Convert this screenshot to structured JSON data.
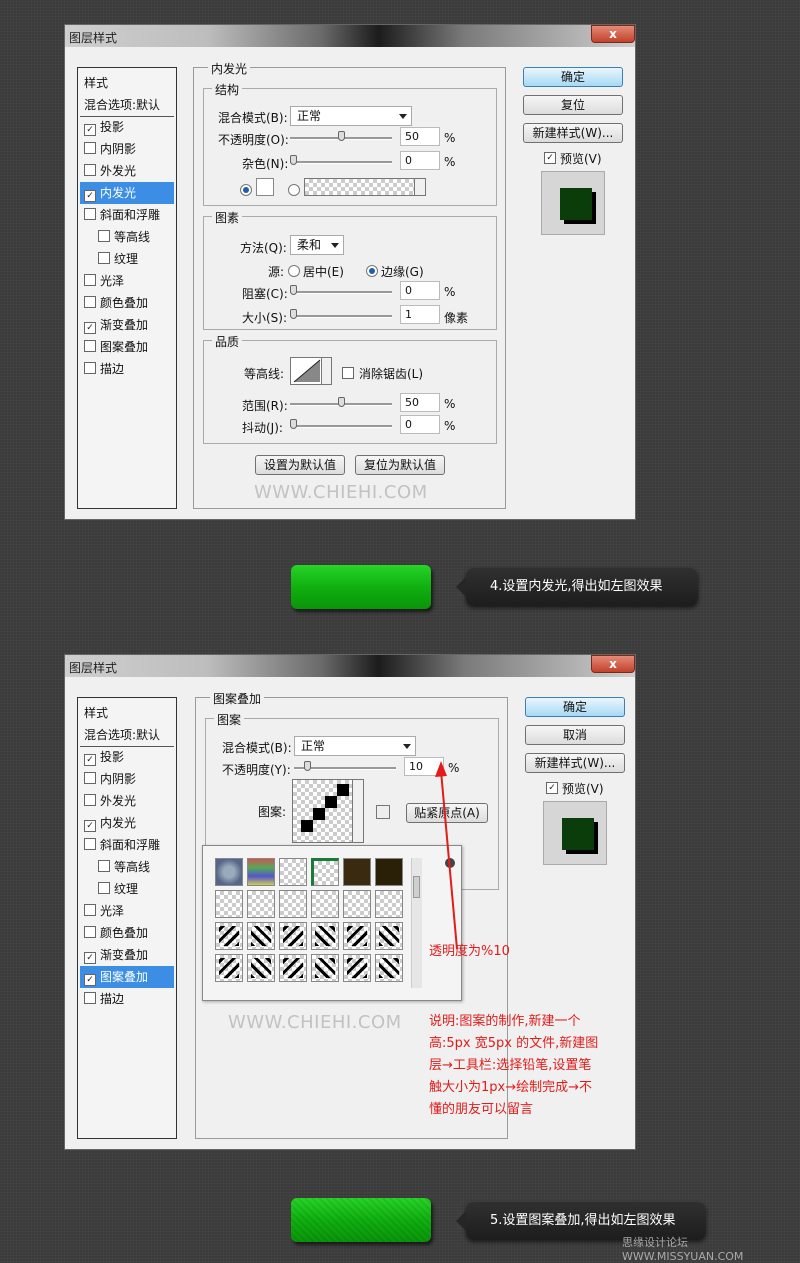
{
  "dialog1": {
    "title": "图层样式",
    "close": "x",
    "list_items": [
      {
        "label": "样式",
        "check": false,
        "checked": false,
        "selected": false,
        "indent": false
      },
      {
        "label": "混合选项:默认",
        "check": false,
        "checked": false,
        "selected": false,
        "indent": false
      },
      {
        "label": "投影",
        "check": true,
        "checked": true,
        "selected": false,
        "indent": false
      },
      {
        "label": "内阴影",
        "check": true,
        "checked": false,
        "selected": false,
        "indent": false
      },
      {
        "label": "外发光",
        "check": true,
        "checked": false,
        "selected": false,
        "indent": false
      },
      {
        "label": "内发光",
        "check": true,
        "checked": true,
        "selected": true,
        "indent": false
      },
      {
        "label": "斜面和浮雕",
        "check": true,
        "checked": false,
        "selected": false,
        "indent": false
      },
      {
        "label": "等高线",
        "check": true,
        "checked": false,
        "selected": false,
        "indent": true
      },
      {
        "label": "纹理",
        "check": true,
        "checked": false,
        "selected": false,
        "indent": true
      },
      {
        "label": "光泽",
        "check": true,
        "checked": false,
        "selected": false,
        "indent": false
      },
      {
        "label": "颜色叠加",
        "check": true,
        "checked": false,
        "selected": false,
        "indent": false
      },
      {
        "label": "渐变叠加",
        "check": true,
        "checked": true,
        "selected": false,
        "indent": false
      },
      {
        "label": "图案叠加",
        "check": true,
        "checked": false,
        "selected": false,
        "indent": false
      },
      {
        "label": "描边",
        "check": true,
        "checked": false,
        "selected": false,
        "indent": false
      }
    ],
    "section_title": "内发光",
    "structure": {
      "title": "结构",
      "blend_label": "混合模式(B):",
      "blend_value": "正常",
      "opacity_label": "不透明度(O):",
      "opacity_value": "50",
      "noise_label": "杂色(N):",
      "noise_value": "0",
      "percent": "%"
    },
    "elements": {
      "title": "图素",
      "method_label": "方法(Q):",
      "method_value": "柔和",
      "source_label": "源:",
      "center_label": "居中(E)",
      "edge_label": "边缘(G)",
      "choke_label": "阻塞(C):",
      "choke_value": "0",
      "size_label": "大小(S):",
      "size_value": "1",
      "px": "像素",
      "percent": "%"
    },
    "quality": {
      "title": "品质",
      "contour_label": "等高线:",
      "antialias_label": "消除锯齿(L)",
      "range_label": "范围(R):",
      "range_value": "50",
      "jitter_label": "抖动(J):",
      "jitter_value": "0",
      "percent": "%"
    },
    "set_default": "设置为默认值",
    "reset_default": "复位为默认值",
    "watermark": "WWW.CHIEHI.COM",
    "ok": "确定",
    "reset": "复位",
    "new_style": "新建样式(W)...",
    "preview_label": "预览(V)"
  },
  "step4": {
    "caption": "4.设置内发光,得出如左图效果"
  },
  "dialog2": {
    "title": "图层样式",
    "close": "x",
    "list_items": [
      {
        "label": "样式",
        "check": false,
        "checked": false,
        "selected": false,
        "indent": false
      },
      {
        "label": "混合选项:默认",
        "check": false,
        "checked": false,
        "selected": false,
        "indent": false
      },
      {
        "label": "投影",
        "check": true,
        "checked": true,
        "selected": false,
        "indent": false
      },
      {
        "label": "内阴影",
        "check": true,
        "checked": false,
        "selected": false,
        "indent": false
      },
      {
        "label": "外发光",
        "check": true,
        "checked": false,
        "selected": false,
        "indent": false
      },
      {
        "label": "内发光",
        "check": true,
        "checked": true,
        "selected": false,
        "indent": false
      },
      {
        "label": "斜面和浮雕",
        "check": true,
        "checked": false,
        "selected": false,
        "indent": false
      },
      {
        "label": "等高线",
        "check": true,
        "checked": false,
        "selected": false,
        "indent": true
      },
      {
        "label": "纹理",
        "check": true,
        "checked": false,
        "selected": false,
        "indent": true
      },
      {
        "label": "光泽",
        "check": true,
        "checked": false,
        "selected": false,
        "indent": false
      },
      {
        "label": "颜色叠加",
        "check": true,
        "checked": false,
        "selected": false,
        "indent": false
      },
      {
        "label": "渐变叠加",
        "check": true,
        "checked": true,
        "selected": false,
        "indent": false
      },
      {
        "label": "图案叠加",
        "check": true,
        "checked": true,
        "selected": true,
        "indent": false
      },
      {
        "label": "描边",
        "check": true,
        "checked": false,
        "selected": false,
        "indent": false
      }
    ],
    "section_title": "图案叠加",
    "pattern_group": "图案",
    "blend_label": "混合模式(B):",
    "blend_value": "正常",
    "opacity_label": "不透明度(Y):",
    "opacity_value": "10",
    "percent": "%",
    "pattern_label": "图案:",
    "snap_origin": "贴紧原点(A)",
    "watermark": "WWW.CHIEHI.COM",
    "ok": "确定",
    "cancel": "取消",
    "new_style": "新建样式(W)...",
    "preview_label": "预览(V)",
    "annotation_opacity": "透明度为%10",
    "annotation_lines": [
      "说明:图案的制作,新建一个",
      "高:5px 宽5px 的文件,新建图",
      "层→工具栏:选择铅笔,设置笔",
      "触大小为1px→绘制完成→不",
      "懂的朋友可以留言"
    ]
  },
  "step5": {
    "caption": "5.设置图案叠加,得出如左图效果"
  },
  "footer": "思缘设计论坛  WWW.MISSYUAN.COM"
}
